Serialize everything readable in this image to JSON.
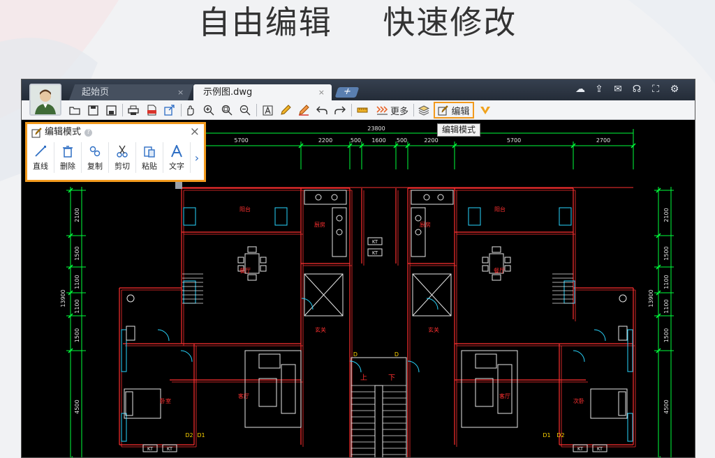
{
  "headline": {
    "left": "自由编辑",
    "right": "快速修改"
  },
  "tabs": {
    "start": {
      "label": "起始页",
      "close": "×"
    },
    "active": {
      "label": "示例图.dwg",
      "close": "×"
    },
    "add": "+"
  },
  "toolbar": {
    "more_label": "更多",
    "edit_label": "编辑",
    "tooltip": "编辑模式"
  },
  "edit_panel": {
    "title": "编辑模式",
    "help": "?",
    "close": "×",
    "tools": [
      "直线",
      "删除",
      "复制",
      "剪切",
      "粘贴",
      "文字"
    ],
    "more": "›"
  },
  "drawing": {
    "overall_dim": "23800",
    "top_dims": [
      "5700",
      "2200",
      "500",
      "1600",
      "500",
      "2200",
      "5700",
      "2700"
    ],
    "left_dims": [
      "2100",
      "1500",
      "1100",
      "1100",
      "1500",
      "4500"
    ],
    "right_dims": [
      "2100",
      "1500",
      "1100",
      "1100",
      "1500",
      "4500"
    ],
    "left_total": "13900",
    "right_total": "13900",
    "room_labels": [
      "阳台",
      "厨房",
      "餐厅",
      "玄关",
      "卧室",
      "客厅",
      "阳台",
      "厨房",
      "餐厅",
      "玄关",
      "客厅",
      "次卧"
    ],
    "stair_labels": [
      "上",
      "下"
    ],
    "door_labels": [
      "D2",
      "D1",
      "D1",
      "D2",
      "D",
      "D"
    ],
    "window_labels": [
      "KT",
      "KT",
      "KT",
      "KT",
      "KT",
      "KT"
    ]
  },
  "colors": {
    "accent": "#f29a1d",
    "wall": "#ff3030",
    "dim": "#00ff3c",
    "bg": "#000000"
  }
}
